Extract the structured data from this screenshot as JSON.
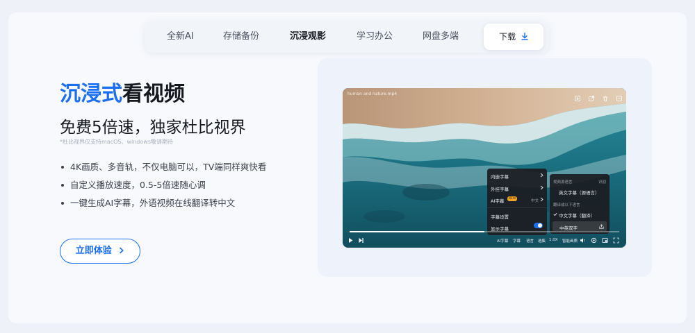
{
  "nav": {
    "items": [
      {
        "label": "全新AI",
        "active": false
      },
      {
        "label": "存储备份",
        "active": false
      },
      {
        "label": "沉浸观影",
        "active": true
      },
      {
        "label": "学习办公",
        "active": false
      },
      {
        "label": "网盘多端",
        "active": false
      }
    ],
    "download_label": "下载"
  },
  "hero": {
    "title_accent": "沉浸式",
    "title_rest": "看视频",
    "subtitle": "免费5倍速，独家杜比视界",
    "note": "*杜比视界仅支持macOS、windows敬请期待",
    "features": [
      "4K画质、多音轨，不仅电脑可以，TV端同样爽快看",
      "自定义播放速度，0.5-5倍速随心调",
      "一键生成AI字幕，外语视频在线翻译转中文"
    ],
    "cta_label": "立即体验"
  },
  "player": {
    "file_name": "human and nature.mp4",
    "menu": {
      "embedded": "内嵌字幕",
      "external": "外挂字幕",
      "ai": "AI字幕",
      "ai_badge": "NEW",
      "ai_lang": "中文",
      "settings": "字幕设置",
      "show": "显示字幕"
    },
    "submenu": {
      "source_label": "视频源语言",
      "identify": "识别",
      "english": "英文字幕（源语言）",
      "translate_label": "翻译成以下语言",
      "chinese": "中文字幕（翻译）",
      "bilingual": "中英双字"
    },
    "controls": {
      "ai_subtitle": "AI字幕",
      "subtitle": "字幕",
      "language": "语言",
      "episodes": "选集",
      "speed": "1.0X",
      "quality": "智能画质"
    },
    "progress": 0.5,
    "show_subtitles": true
  },
  "colors": {
    "accent": "#1d6ff2",
    "badge": "#f0a52b"
  }
}
